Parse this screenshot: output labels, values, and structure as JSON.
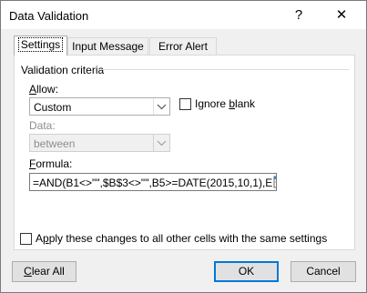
{
  "dialog": {
    "title": "Data Validation",
    "help_label": "?",
    "close_label": "✕"
  },
  "tabs": [
    {
      "label": "Settings",
      "active": true
    },
    {
      "label": "Input Message",
      "active": false
    },
    {
      "label": "Error Alert",
      "active": false
    }
  ],
  "validation": {
    "group_label": "Validation criteria",
    "allow": {
      "label_mnemonic": "A",
      "label_rest": "llow:",
      "value": "Custom"
    },
    "ignore_blank": {
      "label_prefix": "Ignore ",
      "label_mnemonic": "b",
      "label_rest": "lank",
      "checked": false
    },
    "data": {
      "label": "Data:",
      "value": "between",
      "disabled": true
    },
    "formula": {
      "label_mnemonic": "F",
      "label_rest": "ormula:",
      "value": "=AND(B1<>\"\",$B$3<>\"\",B5>=DATE(2015,10,1),E"
    }
  },
  "apply_all": {
    "label_prefix": "A",
    "label_mnemonic": "p",
    "label_rest": "ply these changes to all other cells with the same settings",
    "checked": false
  },
  "buttons": {
    "clear_all": {
      "label_mnemonic": "C",
      "label_rest": "lear All"
    },
    "ok": "OK",
    "cancel": "Cancel"
  },
  "icons": {
    "dropdown": "chevron-down-icon",
    "range_select": "range-select-icon"
  }
}
